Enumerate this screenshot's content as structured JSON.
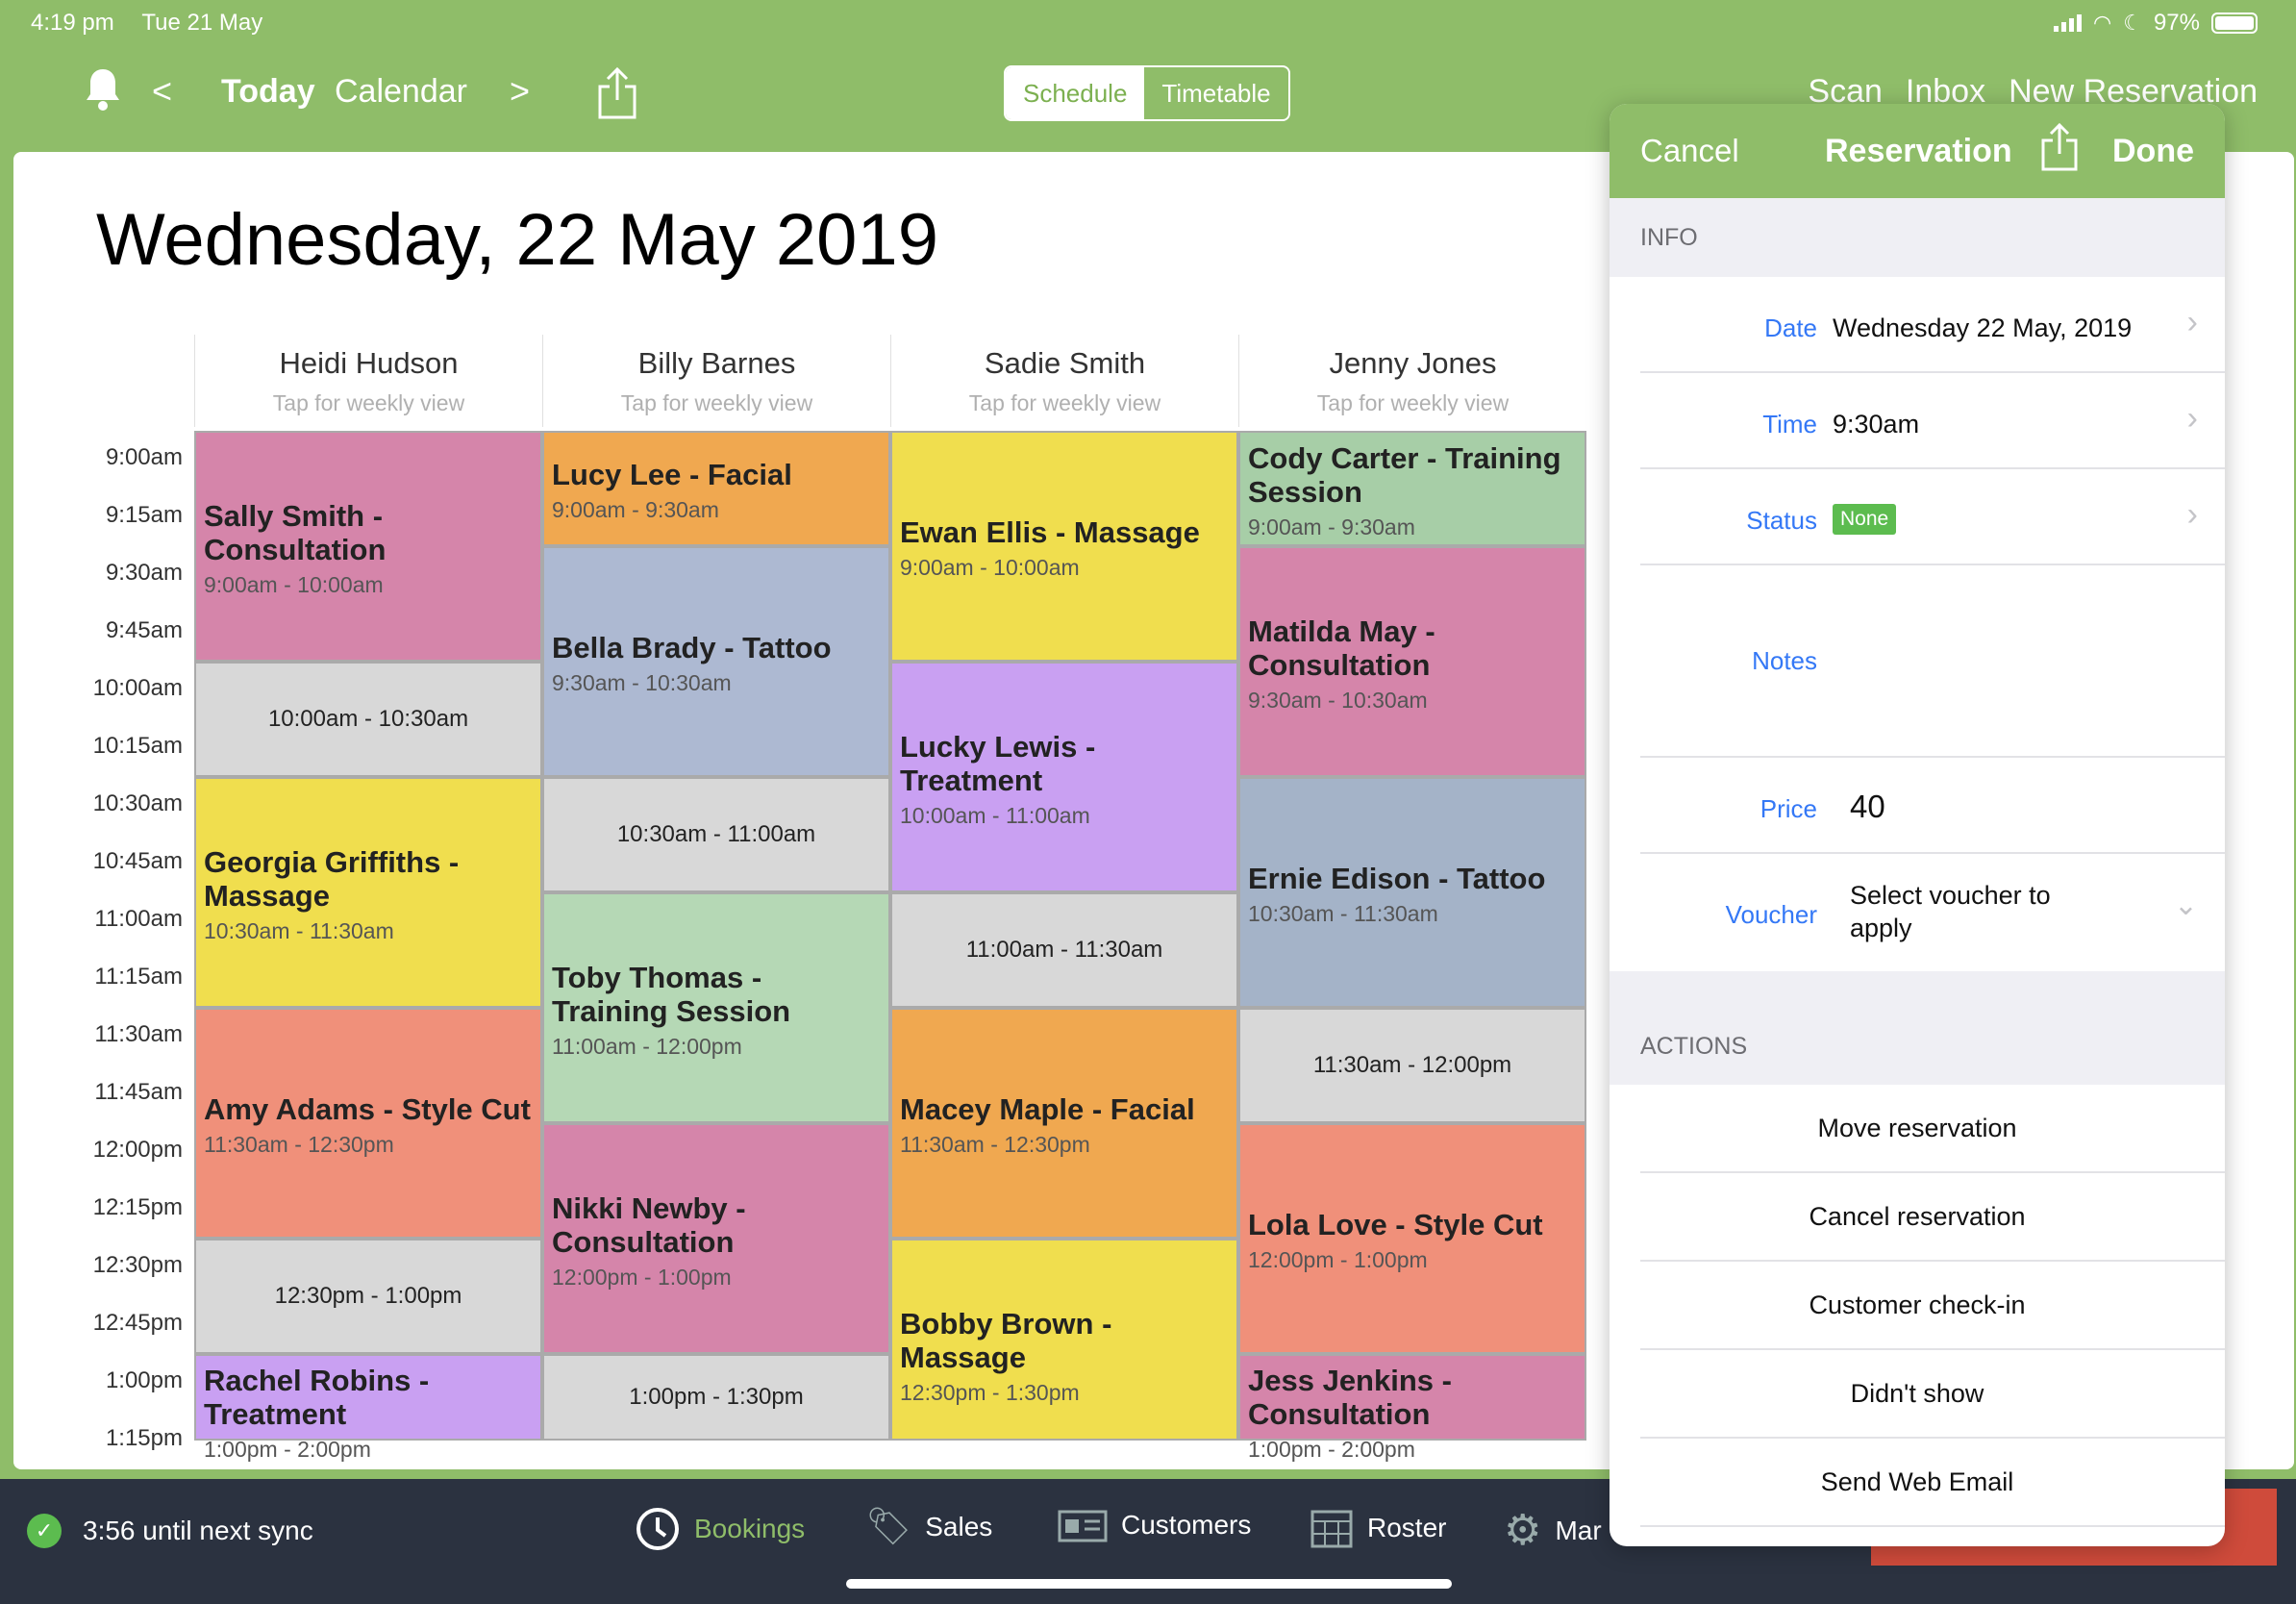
{
  "status_bar": {
    "time": "4:19 pm",
    "date": "Tue 21 May",
    "battery": "97%"
  },
  "top_bar": {
    "prev": "<",
    "today": "Today",
    "calendar": "Calendar",
    "next": ">",
    "view_toggle": {
      "schedule": "Schedule",
      "timetable": "Timetable"
    },
    "links": {
      "scan": "Scan",
      "inbox": "Inbox",
      "new_reservation": "New Reservation"
    }
  },
  "main": {
    "date_title": "Wednesday, 22 May 2019",
    "tap_hint": "Tap for weekly view",
    "staff": [
      "Heidi Hudson",
      "Billy Barnes",
      "Sadie Smith",
      "Jenny Jones"
    ],
    "times": [
      "9:00am",
      "9:15am",
      "9:30am",
      "9:45am",
      "10:00am",
      "10:15am",
      "10:30am",
      "10:45am",
      "11:00am",
      "11:15am",
      "11:30am",
      "11:45am",
      "12:00pm",
      "12:15pm",
      "12:30pm",
      "12:45pm",
      "1:00pm",
      "1:15pm"
    ],
    "bookings": [
      {
        "col": 0,
        "start": 0,
        "slots": 4,
        "title": "Sally Smith - Consultation",
        "time": "9:00am - 10:00am",
        "color": "#d585aa"
      },
      {
        "col": 0,
        "start": 4,
        "slots": 2,
        "free": true,
        "time": "10:00am - 10:30am"
      },
      {
        "col": 0,
        "start": 6,
        "slots": 4,
        "title": "Georgia Griffiths - Massage",
        "time": "10:30am - 11:30am",
        "color": "#f0de4e"
      },
      {
        "col": 0,
        "start": 10,
        "slots": 4,
        "title": "Amy Adams - Style Cut",
        "time": "11:30am - 12:30pm",
        "color": "#f0907a"
      },
      {
        "col": 0,
        "start": 14,
        "slots": 2,
        "free": true,
        "time": "12:30pm - 1:00pm"
      },
      {
        "col": 0,
        "start": 16,
        "slots": 2,
        "title": "Rachel Robins - Treatment",
        "time": "1:00pm - 2:00pm",
        "color": "#c9a0f2"
      },
      {
        "col": 1,
        "start": 0,
        "slots": 2,
        "title": "Lucy Lee - Facial",
        "time": "9:00am - 9:30am",
        "color": "#f0a850"
      },
      {
        "col": 1,
        "start": 2,
        "slots": 4,
        "title": "Bella Brady - Tattoo",
        "time": "9:30am - 10:30am",
        "color": "#adb9d2"
      },
      {
        "col": 1,
        "start": 6,
        "slots": 2,
        "free": true,
        "time": "10:30am - 11:00am"
      },
      {
        "col": 1,
        "start": 8,
        "slots": 4,
        "title": "Toby Thomas - Training Session",
        "time": "11:00am - 12:00pm",
        "color": "#b5d8b5"
      },
      {
        "col": 1,
        "start": 12,
        "slots": 4,
        "title": "Nikki Newby - Consultation",
        "time": "12:00pm - 1:00pm",
        "color": "#d585aa"
      },
      {
        "col": 1,
        "start": 16,
        "slots": 2,
        "free": true,
        "time": "1:00pm - 1:30pm"
      },
      {
        "col": 2,
        "start": 0,
        "slots": 4,
        "title": "Ewan Ellis - Massage",
        "time": "9:00am - 10:00am",
        "color": "#f0de4e"
      },
      {
        "col": 2,
        "start": 4,
        "slots": 4,
        "title": "Lucky Lewis - Treatment",
        "time": "10:00am - 11:00am",
        "color": "#c9a0f2"
      },
      {
        "col": 2,
        "start": 8,
        "slots": 2,
        "free": true,
        "time": "11:00am - 11:30am"
      },
      {
        "col": 2,
        "start": 10,
        "slots": 4,
        "title": "Macey Maple - Facial",
        "time": "11:30am - 12:30pm",
        "color": "#f0a850"
      },
      {
        "col": 2,
        "start": 14,
        "slots": 4,
        "title": "Bobby Brown - Massage",
        "time": "12:30pm - 1:30pm",
        "color": "#f0de4e"
      },
      {
        "col": 3,
        "start": 0,
        "slots": 2,
        "title": "Cody Carter - Training Session",
        "time": "9:00am - 9:30am",
        "color": "#a7cea7"
      },
      {
        "col": 3,
        "start": 2,
        "slots": 4,
        "title": "Matilda May - Consultation",
        "time": "9:30am - 10:30am",
        "color": "#d585aa"
      },
      {
        "col": 3,
        "start": 6,
        "slots": 4,
        "title": "Ernie Edison - Tattoo",
        "time": "10:30am - 11:30am",
        "color": "#a4b3c8"
      },
      {
        "col": 3,
        "start": 10,
        "slots": 2,
        "free": true,
        "time": "11:30am - 12:00pm"
      },
      {
        "col": 3,
        "start": 12,
        "slots": 4,
        "title": "Lola Love - Style Cut",
        "time": "12:00pm - 1:00pm",
        "color": "#f0907a"
      },
      {
        "col": 3,
        "start": 16,
        "slots": 2,
        "title": "Jess Jenkins - Consultation",
        "time": "1:00pm - 2:00pm",
        "color": "#d585aa"
      }
    ]
  },
  "popover": {
    "cancel": "Cancel",
    "title": "Reservation",
    "done": "Done",
    "info_header": "INFO",
    "date_label": "Date",
    "date_value": "Wednesday 22 May, 2019",
    "time_label": "Time",
    "time_value": "9:30am",
    "status_label": "Status",
    "status_value": "None",
    "notes_label": "Notes",
    "price_label": "Price",
    "price_value": "40",
    "voucher_label": "Voucher",
    "voucher_value": "Select voucher to apply",
    "actions_header": "ACTIONS",
    "actions": [
      "Move reservation",
      "Cancel reservation",
      "Customer check-in",
      "Didn't show",
      "Send Web Email"
    ]
  },
  "bottom_bar": {
    "sync": "3:56 until next sync",
    "tabs": {
      "bookings": "Bookings",
      "sales": "Sales",
      "customers": "Customers",
      "roster": "Roster",
      "more": "Mar"
    }
  },
  "colors": {
    "brand_green": "#8fbd69",
    "link_blue": "#3478f6",
    "status_green": "#5cbc4f",
    "bottom_bar": "#2b3240"
  }
}
